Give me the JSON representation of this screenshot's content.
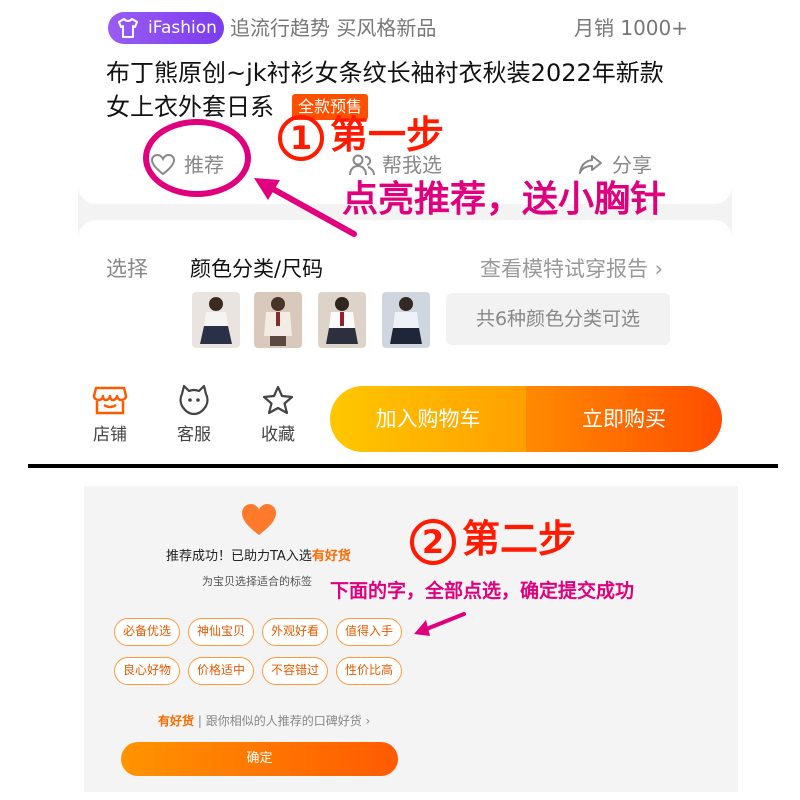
{
  "step1": {
    "brand": {
      "badge": "iFashion",
      "slogan": "追流行趋势 买风格新品",
      "sales": "月销 1000+"
    },
    "title_line1": "布丁熊原创~jk衬衫女条纹长袖衬衣秋装2022年新款",
    "title_line2": "女上衣外套日系",
    "presale_tag": "全款预售",
    "actions": {
      "recommend": "推荐",
      "help_choose": "帮我选",
      "share": "分享"
    },
    "choose": {
      "label": "选择",
      "value": "颜色分类/尺码",
      "tryon_link": "查看模特试穿报告 ›",
      "colors_count": "共6种颜色分类可选"
    },
    "bottom_bar": {
      "shop": "店铺",
      "service": "客服",
      "favorite": "收藏",
      "add_cart": "加入购物车",
      "buy_now": "立即购买"
    },
    "annotation": {
      "number": "1",
      "title": "第一步",
      "hint": "点亮推荐，送小胸针"
    }
  },
  "step2": {
    "success_prefix": "推荐成功！已助力TA入选",
    "success_highlight": "有好货",
    "sub_text": "为宝贝选择适合的标签",
    "tags_row1": [
      "必备优选",
      "神仙宝贝",
      "外观好看",
      "值得入手"
    ],
    "tags_row2": [
      "良心好物",
      "价格适中",
      "不容错过",
      "性价比高"
    ],
    "goods_brand": "有好货",
    "goods_link": " | 跟你相似的人推荐的口碑好货 ›",
    "confirm": "确定",
    "annotation": {
      "number": "2",
      "title": "第二步",
      "hint": "下面的字，全部点选，确定提交成功"
    }
  },
  "colors": {
    "accent_orange": "#ff5000",
    "annotation_red": "#ff1a00",
    "annotation_magenta": "#e0007e",
    "brand_purple": "#8a4af3"
  }
}
